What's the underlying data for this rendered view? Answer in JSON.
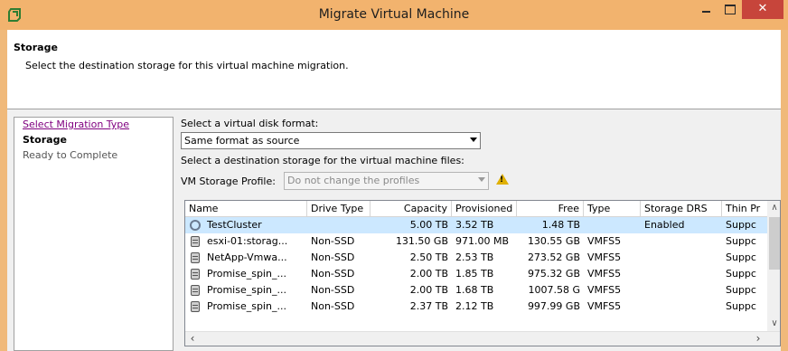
{
  "window": {
    "title": "Migrate Virtual Machine",
    "close_glyph": "✕",
    "accent_color": "#f2b36e",
    "close_color": "#c7453b"
  },
  "header": {
    "title": "Storage",
    "description": "Select the destination storage for this virtual machine migration."
  },
  "steps": [
    {
      "label": "Select Migration Type",
      "state": "visited"
    },
    {
      "label": "Storage",
      "state": "current"
    },
    {
      "label": "Ready to Complete",
      "state": "pending"
    }
  ],
  "disk_format": {
    "label": "Select a virtual disk format:",
    "value": "Same format as source"
  },
  "destination": {
    "label": "Select a destination storage for the virtual machine files:"
  },
  "profile": {
    "label": "VM Storage Profile:",
    "value": "Do not change the profiles",
    "warning_icon": "warning-icon"
  },
  "table": {
    "columns": [
      "Name",
      "Drive Type",
      "Capacity",
      "Provisioned",
      "Free",
      "Type",
      "Storage DRS",
      "Thin Pr"
    ],
    "rows": [
      {
        "icon": "cluster-icon",
        "name": "TestCluster",
        "drive": "",
        "capacity": "5.00 TB",
        "provisioned": "3.52 TB",
        "free": "1.48 TB",
        "type": "",
        "drs": "Enabled",
        "thin": "Suppc",
        "selected": true
      },
      {
        "icon": "datastore-icon",
        "name": "esxi-01:storag...",
        "drive": "Non-SSD",
        "capacity": "131.50 GB",
        "provisioned": "971.00 MB",
        "free": "130.55 GB",
        "type": "VMFS5",
        "drs": "",
        "thin": "Suppc",
        "selected": false
      },
      {
        "icon": "datastore-icon",
        "name": "NetApp-Vmwa...",
        "drive": "Non-SSD",
        "capacity": "2.50 TB",
        "provisioned": "2.53 TB",
        "free": "273.52 GB",
        "type": "VMFS5",
        "drs": "",
        "thin": "Suppc",
        "selected": false
      },
      {
        "icon": "datastore-icon",
        "name": "Promise_spin_...",
        "drive": "Non-SSD",
        "capacity": "2.00 TB",
        "provisioned": "1.85 TB",
        "free": "975.32 GB",
        "type": "VMFS5",
        "drs": "",
        "thin": "Suppc",
        "selected": false
      },
      {
        "icon": "datastore-icon",
        "name": "Promise_spin_...",
        "drive": "Non-SSD",
        "capacity": "2.00 TB",
        "provisioned": "1.68 TB",
        "free": "1007.58 G",
        "type": "VMFS5",
        "drs": "",
        "thin": "Suppc",
        "selected": false
      },
      {
        "icon": "datastore-icon",
        "name": "Promise_spin_...",
        "drive": "Non-SSD",
        "capacity": "2.37 TB",
        "provisioned": "2.12 TB",
        "free": "997.99 GB",
        "type": "VMFS5",
        "drs": "",
        "thin": "Suppc",
        "selected": false
      }
    ],
    "selected_color": "#cce8ff"
  },
  "scroll": {
    "up": "∧",
    "down": "∨",
    "left": "‹",
    "right": "›"
  }
}
